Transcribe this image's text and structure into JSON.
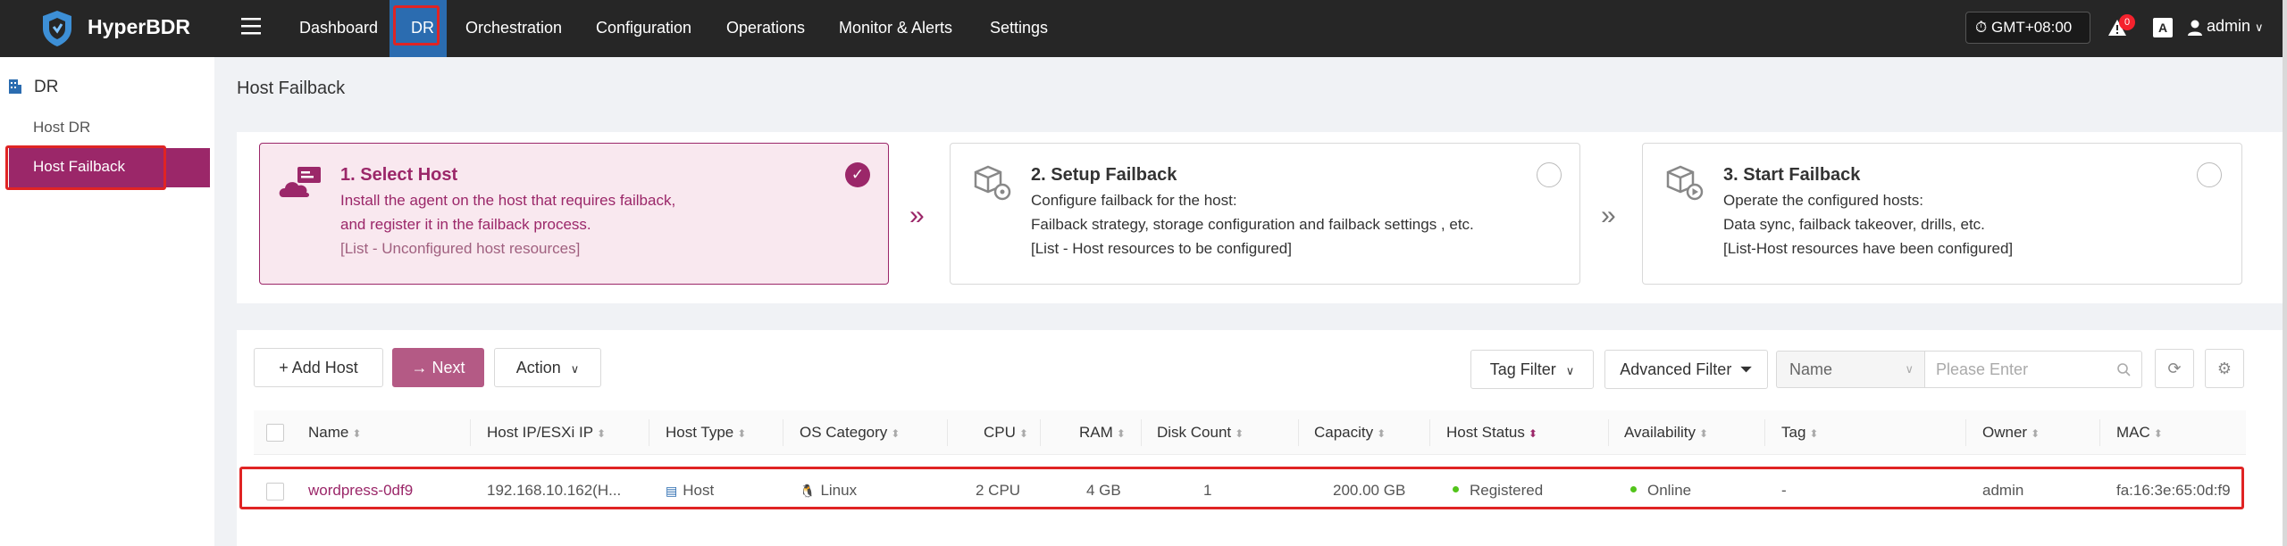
{
  "app": {
    "brand": "HyperBDR"
  },
  "nav": {
    "dashboard": "Dashboard",
    "dr": "DR",
    "orchestration": "Orchestration",
    "configuration": "Configuration",
    "operations": "Operations",
    "monitor": "Monitor & Alerts",
    "settings": "Settings"
  },
  "topbar": {
    "timezone": "GMT+08:00",
    "alert_count": "0",
    "lang_icon": "A",
    "user": "admin"
  },
  "sidebar": {
    "section": "DR",
    "items": [
      {
        "label": "Host DR"
      },
      {
        "label": "Host Failback"
      }
    ]
  },
  "page": {
    "title": "Host Failback"
  },
  "steps": [
    {
      "title": "1. Select Host",
      "line1": "Install the agent on the host that requires failback,",
      "line2": "and register it in the failback process.",
      "line3": "[List - Unconfigured host resources]"
    },
    {
      "title": "2. Setup Failback",
      "line1": "Configure failback for the host:",
      "line2": "Failback strategy, storage configuration and failback settings , etc.",
      "line3": "[List - Host resources to be configured]"
    },
    {
      "title": "3. Start Failback",
      "line1": "Operate the configured hosts:",
      "line2": "Data sync, failback takeover, drills, etc.",
      "line3": "[List-Host resources have been configured]"
    }
  ],
  "toolbar": {
    "add_host": "+ Add Host",
    "next": "→ Next",
    "action": "Action",
    "tag_filter": "Tag Filter",
    "advanced_filter": "Advanced Filter",
    "select_value": "Name",
    "search_placeholder": "Please Enter"
  },
  "table": {
    "headers": {
      "name": "Name",
      "ip": "Host IP/ESXi IP",
      "host_type": "Host Type",
      "os": "OS Category",
      "cpu": "CPU",
      "ram": "RAM",
      "disk": "Disk Count",
      "capacity": "Capacity",
      "status": "Host Status",
      "availability": "Availability",
      "tag": "Tag",
      "owner": "Owner",
      "mac": "MAC"
    },
    "rows": [
      {
        "name": "wordpress-0df9",
        "ip": "192.168.10.162(H...",
        "host_type": "Host",
        "os": "Linux",
        "cpu": "2 CPU",
        "ram": "4 GB",
        "disk": "1",
        "capacity": "200.00 GB",
        "status": "Registered",
        "availability": "Online",
        "tag": "-",
        "owner": "admin",
        "mac": "fa:16:3e:65:0d:f9"
      }
    ]
  },
  "colors": {
    "accent": "#9b2769",
    "topbar": "#262626",
    "nav_active": "#2b6cb0",
    "status_green": "#52c41a",
    "highlight": "#e02424"
  }
}
